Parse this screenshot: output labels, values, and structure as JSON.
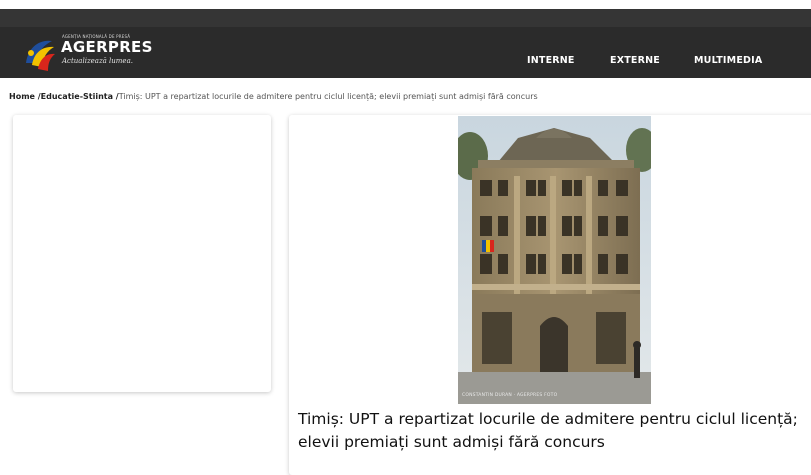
{
  "site": {
    "logo_small_text": "AGENȚIA NAȚIONALĂ DE PRESĂ",
    "logo_name": "AGERPRES",
    "logo_tagline": "Actualizează lumea."
  },
  "nav": {
    "items": [
      {
        "label": "INTERNE"
      },
      {
        "label": "EXTERNE"
      },
      {
        "label": "MULTIMEDIA"
      }
    ]
  },
  "breadcrumb": {
    "home": "Home /",
    "section": "Educatie-Stiinta /",
    "current": "Timiș: UPT a repartizat locurile de admitere pentru ciclul licență; elevii premiați sunt admiși fără concurs"
  },
  "article": {
    "photo_credit": "CONSTANTIN DURAN · AGERPRES FOTO",
    "title": "Timiș: UPT a repartizat locurile de admitere pentru ciclul licență; elevii premiați sunt admiși fără concurs"
  },
  "colors": {
    "header_bg": "#2b2b2b",
    "logo_red": "#d9261c",
    "logo_yellow": "#f2c200",
    "logo_blue": "#1f4e9c"
  }
}
